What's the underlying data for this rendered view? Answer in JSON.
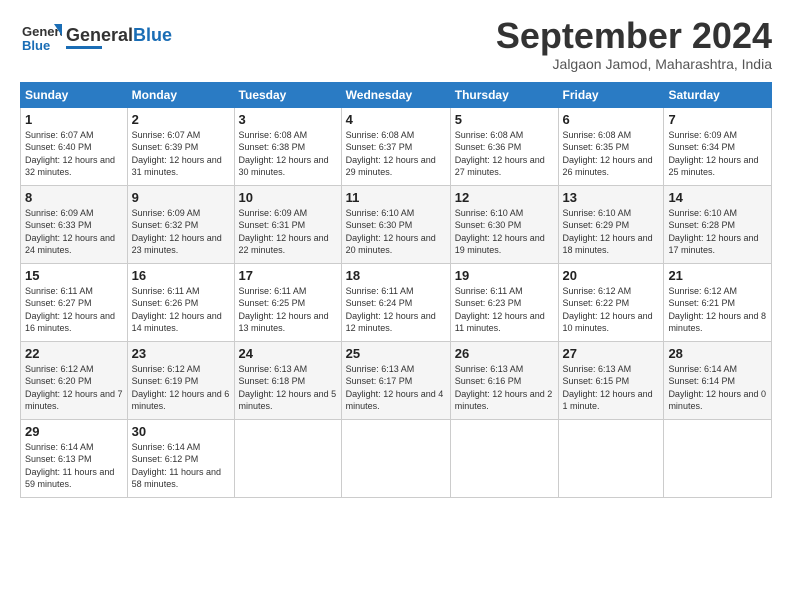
{
  "header": {
    "logo_general": "General",
    "logo_blue": "Blue",
    "month_title": "September 2024",
    "subtitle": "Jalgaon Jamod, Maharashtra, India"
  },
  "days_header": [
    "Sunday",
    "Monday",
    "Tuesday",
    "Wednesday",
    "Thursday",
    "Friday",
    "Saturday"
  ],
  "weeks": [
    [
      {
        "day": "1",
        "sunrise": "Sunrise: 6:07 AM",
        "sunset": "Sunset: 6:40 PM",
        "daylight": "Daylight: 12 hours and 32 minutes."
      },
      {
        "day": "2",
        "sunrise": "Sunrise: 6:07 AM",
        "sunset": "Sunset: 6:39 PM",
        "daylight": "Daylight: 12 hours and 31 minutes."
      },
      {
        "day": "3",
        "sunrise": "Sunrise: 6:08 AM",
        "sunset": "Sunset: 6:38 PM",
        "daylight": "Daylight: 12 hours and 30 minutes."
      },
      {
        "day": "4",
        "sunrise": "Sunrise: 6:08 AM",
        "sunset": "Sunset: 6:37 PM",
        "daylight": "Daylight: 12 hours and 29 minutes."
      },
      {
        "day": "5",
        "sunrise": "Sunrise: 6:08 AM",
        "sunset": "Sunset: 6:36 PM",
        "daylight": "Daylight: 12 hours and 27 minutes."
      },
      {
        "day": "6",
        "sunrise": "Sunrise: 6:08 AM",
        "sunset": "Sunset: 6:35 PM",
        "daylight": "Daylight: 12 hours and 26 minutes."
      },
      {
        "day": "7",
        "sunrise": "Sunrise: 6:09 AM",
        "sunset": "Sunset: 6:34 PM",
        "daylight": "Daylight: 12 hours and 25 minutes."
      }
    ],
    [
      {
        "day": "8",
        "sunrise": "Sunrise: 6:09 AM",
        "sunset": "Sunset: 6:33 PM",
        "daylight": "Daylight: 12 hours and 24 minutes."
      },
      {
        "day": "9",
        "sunrise": "Sunrise: 6:09 AM",
        "sunset": "Sunset: 6:32 PM",
        "daylight": "Daylight: 12 hours and 23 minutes."
      },
      {
        "day": "10",
        "sunrise": "Sunrise: 6:09 AM",
        "sunset": "Sunset: 6:31 PM",
        "daylight": "Daylight: 12 hours and 22 minutes."
      },
      {
        "day": "11",
        "sunrise": "Sunrise: 6:10 AM",
        "sunset": "Sunset: 6:30 PM",
        "daylight": "Daylight: 12 hours and 20 minutes."
      },
      {
        "day": "12",
        "sunrise": "Sunrise: 6:10 AM",
        "sunset": "Sunset: 6:30 PM",
        "daylight": "Daylight: 12 hours and 19 minutes."
      },
      {
        "day": "13",
        "sunrise": "Sunrise: 6:10 AM",
        "sunset": "Sunset: 6:29 PM",
        "daylight": "Daylight: 12 hours and 18 minutes."
      },
      {
        "day": "14",
        "sunrise": "Sunrise: 6:10 AM",
        "sunset": "Sunset: 6:28 PM",
        "daylight": "Daylight: 12 hours and 17 minutes."
      }
    ],
    [
      {
        "day": "15",
        "sunrise": "Sunrise: 6:11 AM",
        "sunset": "Sunset: 6:27 PM",
        "daylight": "Daylight: 12 hours and 16 minutes."
      },
      {
        "day": "16",
        "sunrise": "Sunrise: 6:11 AM",
        "sunset": "Sunset: 6:26 PM",
        "daylight": "Daylight: 12 hours and 14 minutes."
      },
      {
        "day": "17",
        "sunrise": "Sunrise: 6:11 AM",
        "sunset": "Sunset: 6:25 PM",
        "daylight": "Daylight: 12 hours and 13 minutes."
      },
      {
        "day": "18",
        "sunrise": "Sunrise: 6:11 AM",
        "sunset": "Sunset: 6:24 PM",
        "daylight": "Daylight: 12 hours and 12 minutes."
      },
      {
        "day": "19",
        "sunrise": "Sunrise: 6:11 AM",
        "sunset": "Sunset: 6:23 PM",
        "daylight": "Daylight: 12 hours and 11 minutes."
      },
      {
        "day": "20",
        "sunrise": "Sunrise: 6:12 AM",
        "sunset": "Sunset: 6:22 PM",
        "daylight": "Daylight: 12 hours and 10 minutes."
      },
      {
        "day": "21",
        "sunrise": "Sunrise: 6:12 AM",
        "sunset": "Sunset: 6:21 PM",
        "daylight": "Daylight: 12 hours and 8 minutes."
      }
    ],
    [
      {
        "day": "22",
        "sunrise": "Sunrise: 6:12 AM",
        "sunset": "Sunset: 6:20 PM",
        "daylight": "Daylight: 12 hours and 7 minutes."
      },
      {
        "day": "23",
        "sunrise": "Sunrise: 6:12 AM",
        "sunset": "Sunset: 6:19 PM",
        "daylight": "Daylight: 12 hours and 6 minutes."
      },
      {
        "day": "24",
        "sunrise": "Sunrise: 6:13 AM",
        "sunset": "Sunset: 6:18 PM",
        "daylight": "Daylight: 12 hours and 5 minutes."
      },
      {
        "day": "25",
        "sunrise": "Sunrise: 6:13 AM",
        "sunset": "Sunset: 6:17 PM",
        "daylight": "Daylight: 12 hours and 4 minutes."
      },
      {
        "day": "26",
        "sunrise": "Sunrise: 6:13 AM",
        "sunset": "Sunset: 6:16 PM",
        "daylight": "Daylight: 12 hours and 2 minutes."
      },
      {
        "day": "27",
        "sunrise": "Sunrise: 6:13 AM",
        "sunset": "Sunset: 6:15 PM",
        "daylight": "Daylight: 12 hours and 1 minute."
      },
      {
        "day": "28",
        "sunrise": "Sunrise: 6:14 AM",
        "sunset": "Sunset: 6:14 PM",
        "daylight": "Daylight: 12 hours and 0 minutes."
      }
    ],
    [
      {
        "day": "29",
        "sunrise": "Sunrise: 6:14 AM",
        "sunset": "Sunset: 6:13 PM",
        "daylight": "Daylight: 11 hours and 59 minutes."
      },
      {
        "day": "30",
        "sunrise": "Sunrise: 6:14 AM",
        "sunset": "Sunset: 6:12 PM",
        "daylight": "Daylight: 11 hours and 58 minutes."
      },
      null,
      null,
      null,
      null,
      null
    ]
  ]
}
